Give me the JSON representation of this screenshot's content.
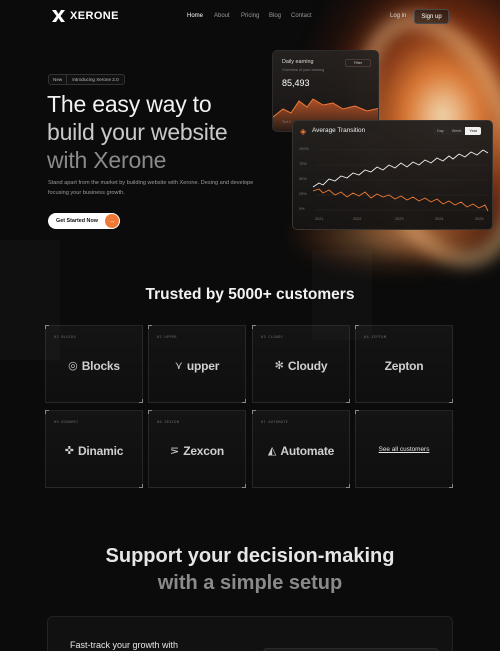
{
  "nav": {
    "brand": "XERONE",
    "links": [
      "Home",
      "About",
      "Pricing",
      "Blog",
      "Contact"
    ],
    "login": "Log in",
    "signup": "Sign up"
  },
  "hero": {
    "badge_new": "New",
    "badge_text": "Introducing Xerone 2.0",
    "title_line1": "The easy way to",
    "title_line2": "build your website",
    "title_line3": "with Xerone",
    "description": "Stand apart from the market by building website with Xerone. Desing and develope focusing your business growth.",
    "cta": "Get Started Now",
    "cta_icon": "arrow-right-icon"
  },
  "daily_card": {
    "title": "Daily earning",
    "subtitle": "Overview of your earning",
    "value": "85,493",
    "pill": "Filter",
    "axis_label": "Tod 2"
  },
  "avg_card": {
    "title": "Average Transition",
    "toggle": [
      "Day",
      "Week",
      "Year"
    ],
    "toggle_active": "Year",
    "y_ticks": [
      "100%",
      "75%",
      "50%",
      "25%",
      "0%"
    ],
    "x_ticks": [
      "2021",
      "2022",
      "2023",
      "2024",
      "2025"
    ],
    "colors": {
      "primary_line": "#f2f2f2",
      "secondary_line": "#f07a35"
    }
  },
  "trusted": {
    "heading": "Trusted by 5000+ customers",
    "cells": [
      {
        "tag": "01 BLOCKS",
        "name": "Blocks",
        "icon": "blocks-icon",
        "glyph": "◎"
      },
      {
        "tag": "02 UPPER",
        "name": "upper",
        "icon": "upper-icon",
        "glyph": "⋎"
      },
      {
        "tag": "03 CLOUDY",
        "name": "Cloudy",
        "icon": "cloudy-icon",
        "glyph": "✻"
      },
      {
        "tag": "04 ZEPTON",
        "name": "Zepton",
        "icon": "",
        "glyph": ""
      },
      {
        "tag": "05 DINAMIC",
        "name": "Dinamic",
        "icon": "dinamic-icon",
        "glyph": "✜"
      },
      {
        "tag": "06 ZEXCON",
        "name": "Zexcon",
        "icon": "zexcon-icon",
        "glyph": "⋝"
      },
      {
        "tag": "07 AUTOMATE",
        "name": "Automate",
        "icon": "automate-icon",
        "glyph": "◭"
      }
    ],
    "see_all": "See all customers"
  },
  "support": {
    "line1": "Support your decision-making",
    "line2": "with a simple setup"
  },
  "bottom_panel": {
    "text": "Fast-track your growth with"
  },
  "brand_colors": {
    "accent": "#f07a35",
    "background": "#0b0b0b"
  }
}
